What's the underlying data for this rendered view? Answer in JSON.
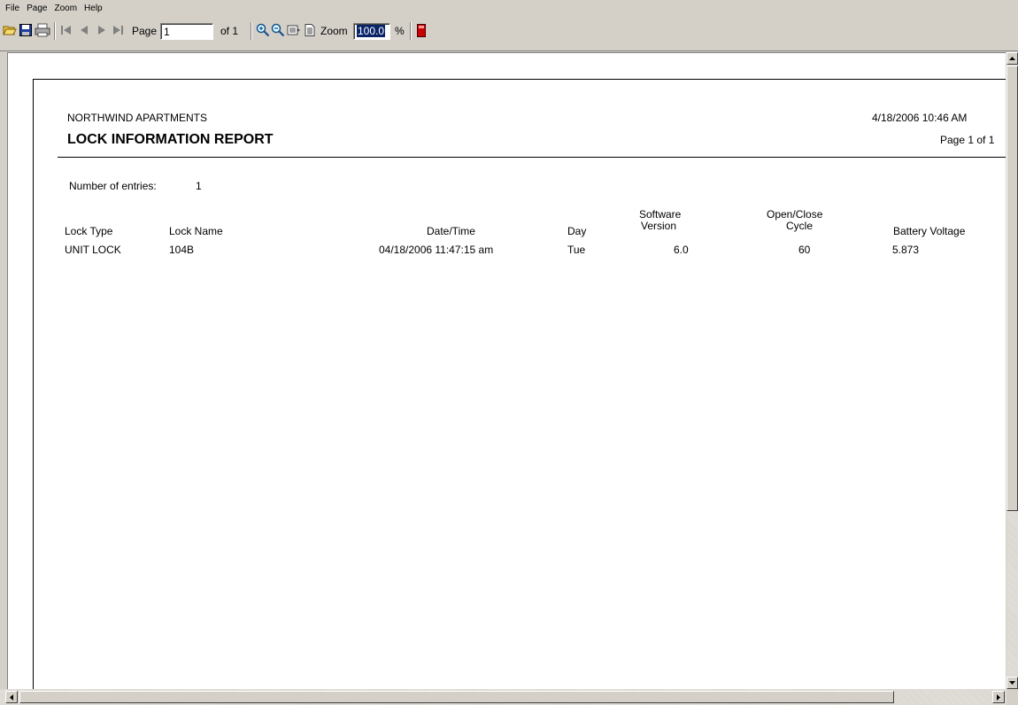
{
  "menu": [
    "File",
    "Page",
    "Zoom",
    "Help"
  ],
  "toolbar": {
    "icons": [
      "open-folder-icon",
      "save-disk-icon",
      "print-icon",
      "first-page-icon",
      "previous-page-icon",
      "next-page-icon",
      "last-page-icon",
      "zoom-in-icon",
      "zoom-out-icon",
      "fit-width-icon",
      "fit-page-icon",
      "stop-icon"
    ],
    "page_label": "Page",
    "page_value": "1",
    "of_label": "of 1",
    "zoom_label": "Zoom",
    "zoom_value": "100.0",
    "percent_label": "%"
  },
  "report": {
    "company": "NORTHWIND APARTMENTS",
    "title": "LOCK INFORMATION REPORT",
    "datetime": "4/18/2006   10:46 AM",
    "page_info": "Page  1  of  1",
    "entries_label": "Number of entries:",
    "entries_value": "1",
    "columns": {
      "lock_type": "Lock Type",
      "lock_name": "Lock Name",
      "datetime": "Date/Time",
      "day": "Day",
      "software_version_1": "Software",
      "software_version_2": "Version",
      "open_close_1": "Open/Close",
      "open_close_2": "Cycle",
      "battery_voltage": "Battery Voltage"
    },
    "rows": [
      {
        "lock_type": "UNIT LOCK",
        "lock_name": "104B",
        "datetime": "04/18/2006 11:47:15 am",
        "day": "Tue",
        "software_version": "6.0",
        "open_close_cycle": "60",
        "battery_voltage": "5.873"
      }
    ]
  },
  "colors": {
    "chrome": "#d4d0c8",
    "selection": "#0a246a",
    "stop_icon": "#cc0000"
  }
}
